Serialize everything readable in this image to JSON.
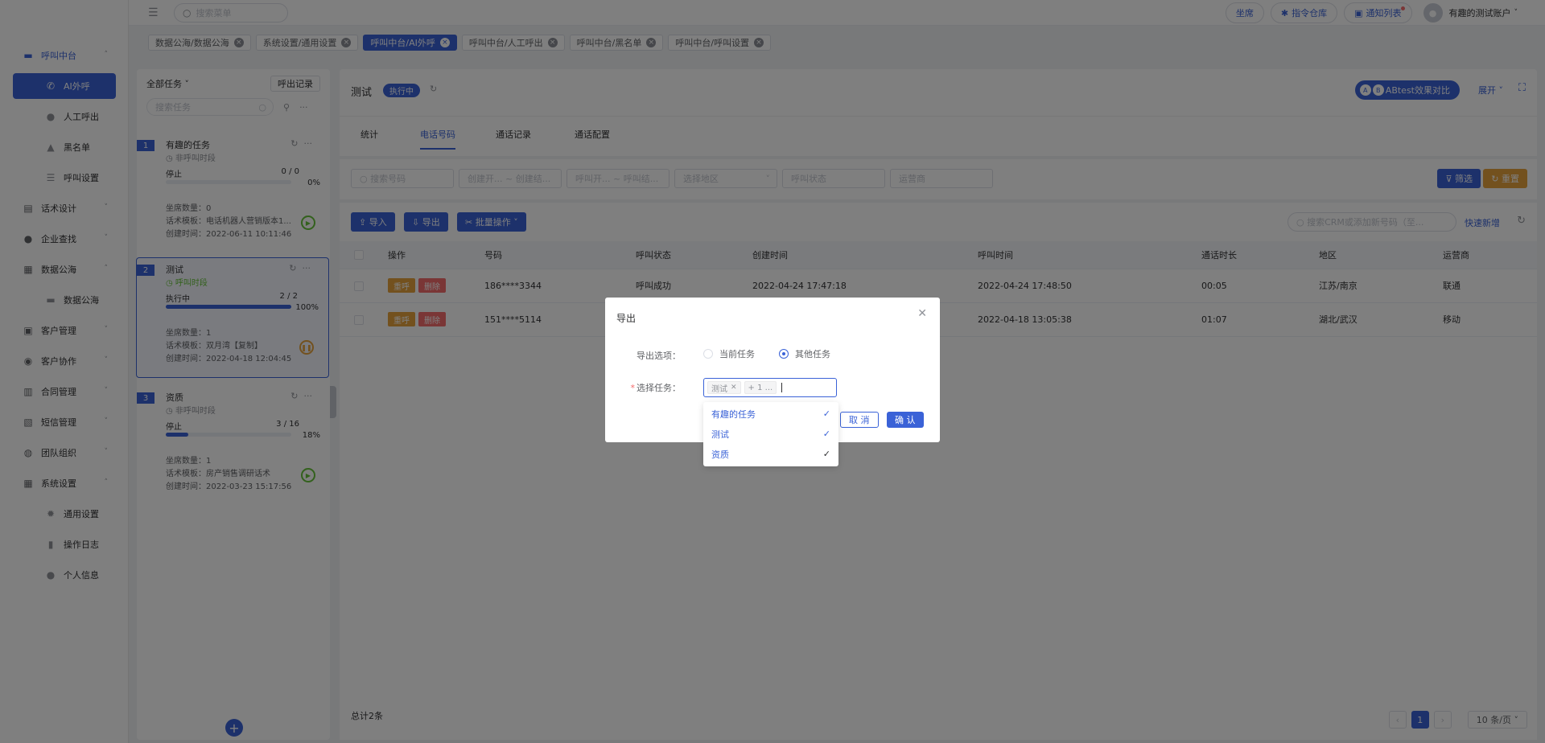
{
  "topbar": {
    "search_placeholder": "搜索菜单",
    "seat": "坐席",
    "command_library": "指令仓库",
    "notice_list": "通知列表",
    "user_name": "有趣的测试账户"
  },
  "sidebar": [
    {
      "label": "呼叫中台",
      "icon": "phone-desk-icon",
      "arrow": "˄",
      "state": "open"
    },
    {
      "label": "AI外呼",
      "icon": "phone-icon",
      "state": "active",
      "sub": true
    },
    {
      "label": "人工呼出",
      "icon": "person-icon",
      "sub": true
    },
    {
      "label": "黑名单",
      "icon": "warning-icon",
      "sub": true
    },
    {
      "label": "呼叫设置",
      "icon": "sliders-icon",
      "sub": true
    },
    {
      "label": "话术设计",
      "icon": "script-icon",
      "arrow": "˅"
    },
    {
      "label": "企业查找",
      "icon": "bulb-icon",
      "arrow": "˅"
    },
    {
      "label": "数据公海",
      "icon": "database-icon",
      "arrow": "˄"
    },
    {
      "label": "数据公海",
      "icon": "table-icon",
      "sub": true
    },
    {
      "label": "客户管理",
      "icon": "customer-icon",
      "arrow": "˅"
    },
    {
      "label": "客户协作",
      "icon": "collab-icon",
      "arrow": "˅"
    },
    {
      "label": "合同管理",
      "icon": "contract-icon",
      "arrow": "˅"
    },
    {
      "label": "短信管理",
      "icon": "sms-icon",
      "arrow": "˅"
    },
    {
      "label": "团队组织",
      "icon": "team-icon",
      "arrow": "˅"
    },
    {
      "label": "系统设置",
      "icon": "grid-icon",
      "arrow": "˄"
    },
    {
      "label": "通用设置",
      "icon": "gear-icon",
      "sub": true
    },
    {
      "label": "操作日志",
      "icon": "log-icon",
      "sub": true
    },
    {
      "label": "个人信息",
      "icon": "user-icon",
      "sub": true
    }
  ],
  "tags": [
    {
      "label": "数据公海/数据公海",
      "active": false
    },
    {
      "label": "系统设置/通用设置",
      "active": false
    },
    {
      "label": "呼叫中台/AI外呼",
      "active": true
    },
    {
      "label": "呼叫中台/人工呼出",
      "active": false
    },
    {
      "label": "呼叫中台/黑名单",
      "active": false
    },
    {
      "label": "呼叫中台/呼叫设置",
      "active": false
    }
  ],
  "task_list": {
    "filter": "全部任务",
    "record_btn": "呼出记录",
    "search_placeholder": "搜索任务",
    "tasks": [
      {
        "num": "1",
        "name": "有趣的任务",
        "status": "非呼叫时段",
        "status_color": "gray",
        "state": "停止",
        "progress": "0 / 0",
        "pct": "0%",
        "fill": 0,
        "seats": "坐席数量：0",
        "template": "话术模板：电话机器人营销版本1...",
        "created": "创建时间：2022-06-11 10:11:46",
        "btn": "play"
      },
      {
        "num": "2",
        "name": "测试",
        "status": "呼叫时段",
        "status_color": "green",
        "state": "执行中",
        "progress": "2 / 2",
        "pct": "100%",
        "fill": 1,
        "seats": "坐席数量：1",
        "template": "话术模板：双月湾【复制】",
        "created": "创建时间：2022-04-18 12:04:45",
        "btn": "pause",
        "selected": true
      },
      {
        "num": "3",
        "name": "资质",
        "status": "非呼叫时段",
        "status_color": "gray",
        "state": "停止",
        "progress": "3 / 16",
        "pct": "18%",
        "fill": 0.18,
        "seats": "坐席数量：1",
        "template": "话术模板：房产销售调研话术",
        "created": "创建时间：2022-03-23 15:17:56",
        "btn": "play"
      }
    ]
  },
  "main": {
    "title": "测试",
    "badge": "执行中",
    "ab_label": "ABtest效果对比",
    "expand": "展开 ˅",
    "tabs": [
      "统计",
      "电话号码",
      "通话记录",
      "通话配置"
    ],
    "active_tab": 1,
    "filters": {
      "search_number": "搜索号码",
      "created_range": "创建开... ~ 创建结...",
      "call_range": "呼叫开... ~ 呼叫结...",
      "region": "选择地区",
      "call_status": "呼叫状态",
      "carrier": "运营商",
      "filter_btn": "筛选",
      "reset_btn": "重置"
    },
    "toolbar": {
      "import": "导入",
      "export": "导出",
      "batch": "批量操作 ˅",
      "crm_placeholder": "搜索CRM或添加新号码（至...",
      "quick_add": "快速新增"
    },
    "columns": [
      "操作",
      "号码",
      "呼叫状态",
      "创建时间",
      "呼叫时间",
      "通话时长",
      "地区",
      "运营商"
    ],
    "rows": [
      {
        "phone": "186****3344",
        "status": "呼叫成功",
        "created": "2022-04-24 17:47:18",
        "called": "2022-04-24 17:48:50",
        "duration": "00:05",
        "region": "江苏/南京",
        "carrier": "联通"
      },
      {
        "phone": "151****5114",
        "status": "",
        "created": "",
        "called": "2022-04-18 13:05:38",
        "duration": "01:07",
        "region": "湖北/武汉",
        "carrier": "移动"
      }
    ],
    "row_btn_call": "重呼",
    "row_btn_delete": "删除",
    "total": "总计2条",
    "page": "1",
    "page_size": "10 条/页 ˅"
  },
  "dialog": {
    "title": "导出",
    "export_option_label": "导出选项：",
    "option_current": "当前任务",
    "option_other": "其他任务",
    "select_task_label": "选择任务：",
    "chip_1": "测试",
    "chip_more": "+ 1 ...",
    "cancel": "取 消",
    "confirm": "确 认",
    "dropdown": [
      "有趣的任务",
      "测试",
      "资质"
    ]
  },
  "colors": {
    "primary": "#3a62d7",
    "warning": "#e6a23c",
    "danger": "#f56c6c",
    "success": "#67c23a"
  }
}
